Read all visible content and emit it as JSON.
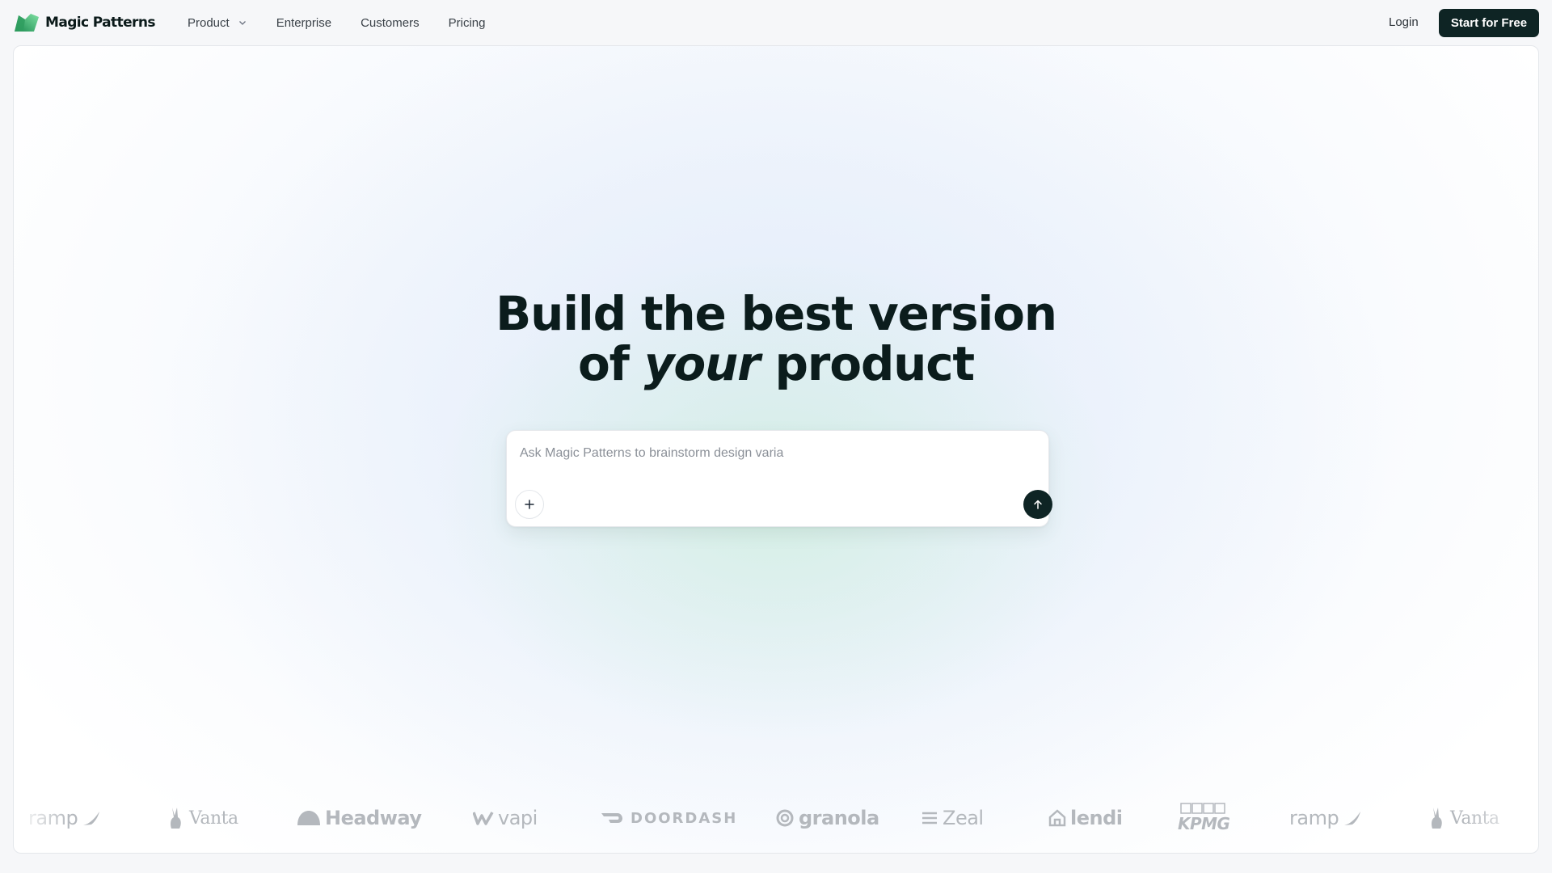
{
  "nav": {
    "brand": "Magic Patterns",
    "links": [
      {
        "label": "Product",
        "has_dropdown": true
      },
      {
        "label": "Enterprise"
      },
      {
        "label": "Customers"
      },
      {
        "label": "Pricing"
      }
    ],
    "login": "Login",
    "cta": "Start for Free"
  },
  "hero": {
    "line1": "Build the best version",
    "line2_before": "of",
    "line2_emph": "your",
    "line2_after": "product"
  },
  "prompt": {
    "value": "",
    "placeholder": "Ask Magic Patterns to brainstorm design varia",
    "add_icon": "plus-icon",
    "send_icon": "arrow-up-icon"
  },
  "logos": [
    {
      "name": "ramp",
      "icon": "ramp-wing-icon"
    },
    {
      "name": "Vanta",
      "icon": "vanta-rabbit-icon"
    },
    {
      "name": "Headway",
      "icon": "headway-dome-icon"
    },
    {
      "name": "vapi",
      "icon": "vapi-wave-icon"
    },
    {
      "name": "DOORDASH",
      "icon": "doordash-dash-icon"
    },
    {
      "name": "granola",
      "icon": "granola-swirl-icon"
    },
    {
      "name": "Zeal",
      "icon": "zeal-lines-icon"
    },
    {
      "name": "lendi",
      "icon": "lendi-house-icon"
    },
    {
      "name": "KPMG",
      "icon": "kpmg-boxes-icon"
    },
    {
      "name": "ramp",
      "icon": "ramp-wing-icon"
    },
    {
      "name": "Vanta",
      "icon": "vanta-rabbit-icon"
    }
  ],
  "colors": {
    "primary": "#0e2424",
    "logo_gray": "#b4b8bd",
    "brand_green": "#3fb36b"
  }
}
